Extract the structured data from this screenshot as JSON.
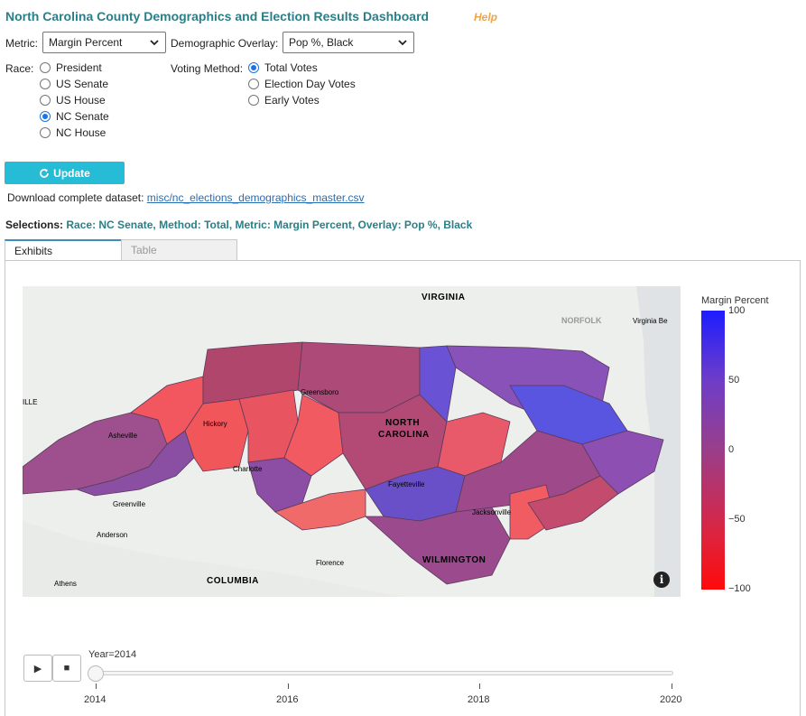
{
  "header": {
    "title": "North Carolina County Demographics and Election Results Dashboard",
    "help": "Help"
  },
  "controls": {
    "metric_label": "Metric:",
    "metric_value": "Margin Percent",
    "overlay_label": "Demographic Overlay:",
    "overlay_value": "Pop %, Black",
    "race_label": "Race:",
    "races": [
      {
        "label": "President",
        "selected": false
      },
      {
        "label": "US Senate",
        "selected": false
      },
      {
        "label": "US House",
        "selected": false
      },
      {
        "label": "NC Senate",
        "selected": true
      },
      {
        "label": "NC House",
        "selected": false
      }
    ],
    "method_label": "Voting Method:",
    "methods": [
      {
        "label": "Total Votes",
        "selected": true
      },
      {
        "label": "Election Day Votes",
        "selected": false
      },
      {
        "label": "Early Votes",
        "selected": false
      }
    ],
    "update_label": "Update"
  },
  "download": {
    "prefix": "Download complete dataset:",
    "link": "misc/nc_elections_demographics_master.csv"
  },
  "selections": {
    "prefix": "Selections:",
    "value": "Race: NC Senate, Method: Total, Metric: Margin Percent, Overlay: Pop %, Black"
  },
  "tabs": [
    "Exhibits",
    "Table"
  ],
  "map": {
    "places": {
      "virginia": "VIRGINIA",
      "norfolk": "NORFOLK",
      "virginia_beach": "Virginia Be",
      "ville": "ILLE",
      "greensboro": "Greensboro",
      "asheville": "Asheville",
      "hickory": "Hickory",
      "north_carolina_1": "NORTH",
      "north_carolina_2": "CAROLINA",
      "charlotte": "Charlotte",
      "fayetteville": "Fayetteville",
      "jacksonville": "Jacksonville",
      "greenville": "Greenville",
      "anderson": "Anderson",
      "florence": "Florence",
      "wilmington": "WILMINGTON",
      "athens": "Athens",
      "columbia": "COLUMBIA"
    },
    "info": "i"
  },
  "colorbar": {
    "title": "Margin Percent",
    "ticks": [
      "100",
      "50",
      "0",
      "−50",
      "−100"
    ],
    "range": [
      -100,
      100
    ],
    "colors": [
      "#1d1dff",
      "#9a3e8a",
      "#ff0a0a"
    ]
  },
  "slider": {
    "label": "Year=2014",
    "current": 2014,
    "years": [
      "2014",
      "2016",
      "2018",
      "2020"
    ]
  }
}
